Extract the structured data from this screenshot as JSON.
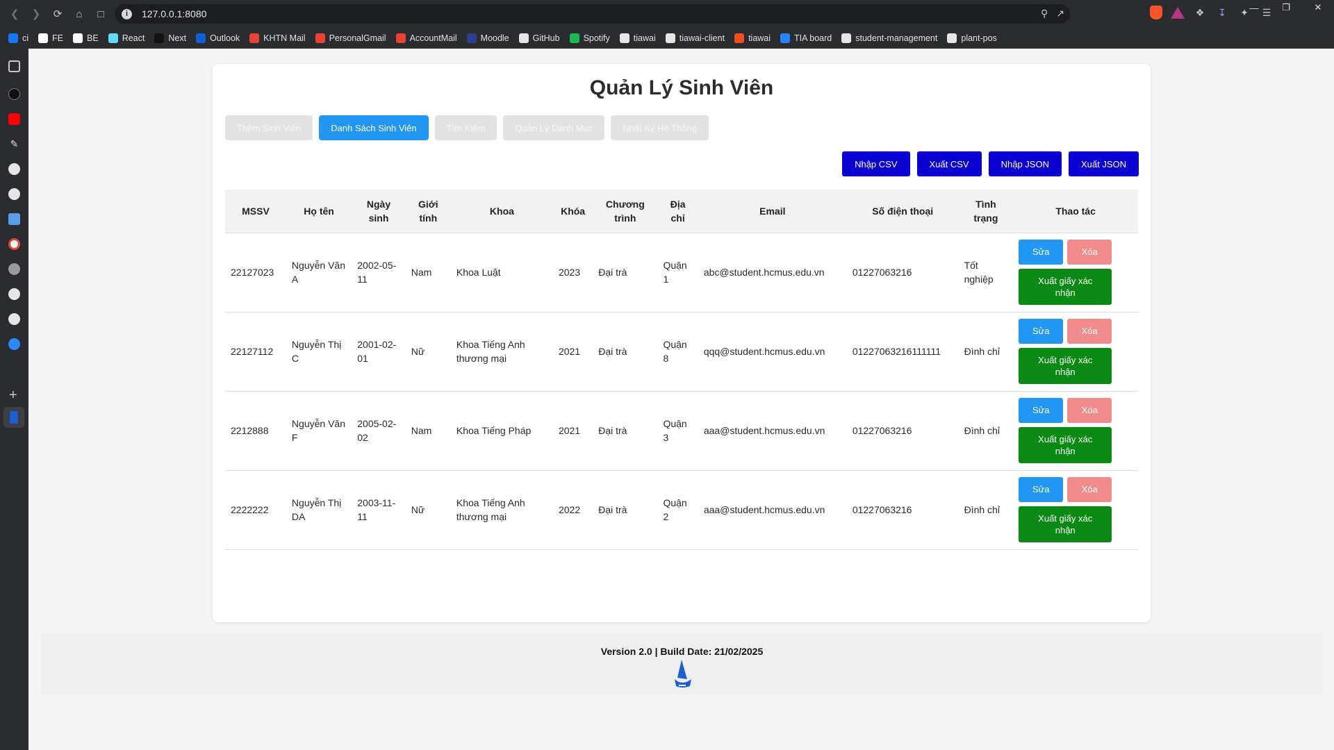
{
  "browser": {
    "url": "127.0.0.1:8080",
    "bookmarks": [
      {
        "label": "ci",
        "color": "#1877f2"
      },
      {
        "label": "FE",
        "color": "#ffffff"
      },
      {
        "label": "BE",
        "color": "#ffffff"
      },
      {
        "label": "React",
        "color": "#61dafb"
      },
      {
        "label": "Next",
        "color": "#111111"
      },
      {
        "label": "Outlook",
        "color": "#0a64d6"
      },
      {
        "label": "KHTN Mail",
        "color": "#ea4335"
      },
      {
        "label": "PersonalGmail",
        "color": "#ea4335"
      },
      {
        "label": "AccountMail",
        "color": "#ea4335"
      },
      {
        "label": "Moodle",
        "color": "#2f3d8f"
      },
      {
        "label": "GitHub",
        "color": "#e6e6e6"
      },
      {
        "label": "Spotify",
        "color": "#1db954"
      },
      {
        "label": "tiawai",
        "color": "#e6e6e6"
      },
      {
        "label": "tiawai-client",
        "color": "#e6e6e6"
      },
      {
        "label": "tiawai",
        "color": "#f24e1e"
      },
      {
        "label": "TIA board",
        "color": "#2684ff"
      },
      {
        "label": "student-management",
        "color": "#e6e6e6"
      },
      {
        "label": "plant-pos",
        "color": "#e6e6e6"
      }
    ]
  },
  "app": {
    "title": "Quản Lý Sinh Viên",
    "tabs": [
      "Thêm Sinh Viên",
      "Danh Sách Sinh Viên",
      "Tìm Kiếm",
      "Quản Lý Danh Mục",
      "Nhật Ký Hệ Thống"
    ],
    "active_tab": "Danh Sách Sinh Viên",
    "io_buttons": [
      "Nhập CSV",
      "Xuất CSV",
      "Nhập JSON",
      "Xuất JSON"
    ],
    "columns": [
      "MSSV",
      "Họ tên",
      "Ngày sinh",
      "Giới tính",
      "Khoa",
      "Khóa",
      "Chương trình",
      "Địa chỉ",
      "Email",
      "Số điện thoại",
      "Tình trạng",
      "Thao tác"
    ],
    "actions": {
      "edit": "Sửa",
      "delete": "Xóa",
      "certificate": "Xuất giấy xác nhận"
    },
    "students": [
      {
        "mssv": "22127023",
        "name": "Nguyễn Văn A",
        "dob": "2002-05-11",
        "gender": "Nam",
        "faculty": "Khoa Luật",
        "year": "2023",
        "program": "Đại trà",
        "address": "Quận 1",
        "email": "abc@student.hcmus.edu.vn",
        "phone": "01227063216",
        "status": "Tốt nghiệp"
      },
      {
        "mssv": "22127112",
        "name": "Nguyễn Thị C",
        "dob": "2001-02-01",
        "gender": "Nữ",
        "faculty": "Khoa Tiếng Anh thương mại",
        "year": "2021",
        "program": "Đại trà",
        "address": "Quận 8",
        "email": "qqq@student.hcmus.edu.vn",
        "phone": "01227063216111111",
        "status": "Đình chỉ"
      },
      {
        "mssv": "2212888",
        "name": "Nguyễn Văn F",
        "dob": "2005-02-02",
        "gender": "Nam",
        "faculty": "Khoa Tiếng Pháp",
        "year": "2021",
        "program": "Đại trà",
        "address": "Quận 3",
        "email": "aaa@student.hcmus.edu.vn",
        "phone": "01227063216",
        "status": "Đình chỉ"
      },
      {
        "mssv": "2222222",
        "name": "Nguyễn Thị DA",
        "dob": "2003-11-11",
        "gender": "Nữ",
        "faculty": "Khoa Tiếng Anh thương mại",
        "year": "2022",
        "program": "Đại trà",
        "address": "Quận 2",
        "email": "aaa@student.hcmus.edu.vn",
        "phone": "01227063216",
        "status": "Đình chỉ"
      }
    ],
    "footer": "Version 2.0 | Build Date: 21/02/2025"
  }
}
